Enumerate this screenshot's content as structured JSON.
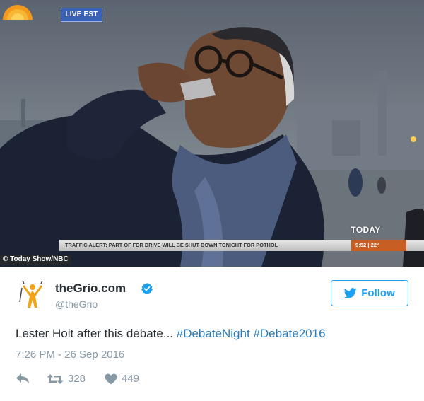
{
  "media": {
    "live_badge": "LIVE EST",
    "network_logo_text": "TODAY",
    "ticker": {
      "text": "TRAFFIC ALERT:  PART OF FDR DRIVE WILL BE SHUT DOWN TONIGHT FOR POTHOL",
      "time": "9:52",
      "temperature": "22°"
    },
    "credit": "© Today Show/NBC",
    "colors": {
      "ticker_time_bg": "#c75f25",
      "live_badge_bg": "#3a63b8"
    }
  },
  "tweet": {
    "display_name": "theGrio.com",
    "handle": "@theGrio",
    "verified_icon": "verified-badge-icon",
    "follow_label": "Follow",
    "text_plain": "Lester Holt after this debate... ",
    "hashtags": [
      "#DebateNight",
      "#Debate2016"
    ],
    "timestamp": "7:26 PM - 26 Sep 2016",
    "actions": {
      "reply_icon": "reply-icon",
      "retweet_icon": "retweet-icon",
      "retweet_count": "328",
      "like_icon": "heart-icon",
      "like_count": "449"
    },
    "colors": {
      "link": "#2b7bb9",
      "muted": "#8899a6",
      "brand": "#1da1f2"
    }
  }
}
